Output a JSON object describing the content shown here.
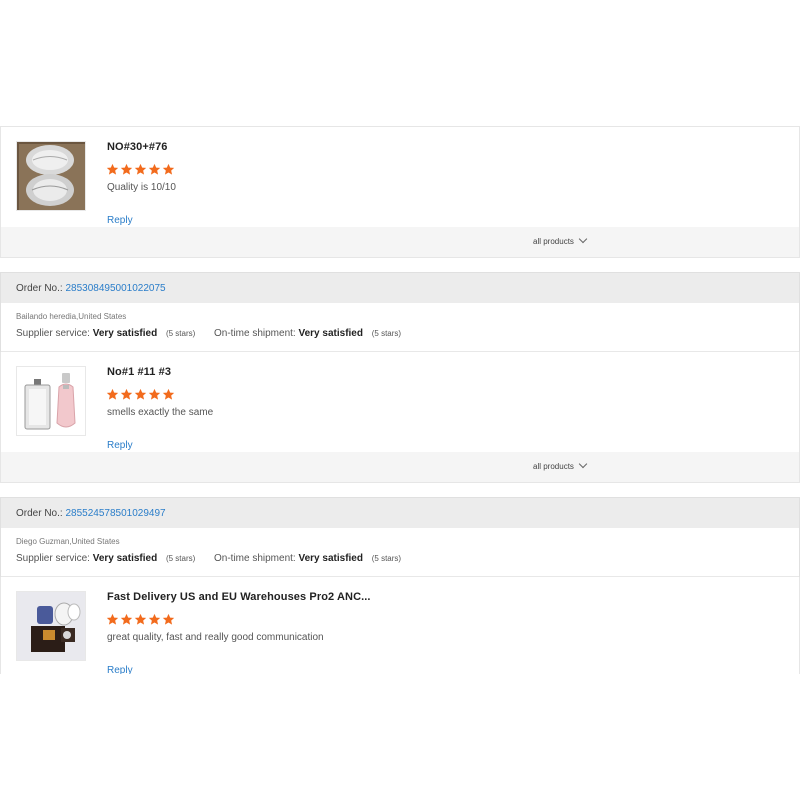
{
  "reviews_feed": {
    "first_item": {
      "product_name": "NO#30+#76",
      "rating": 5,
      "text": "Quality is 10/10",
      "reply_label": "Reply",
      "all_products_label": "all products"
    },
    "orders": [
      {
        "order_label": "Order No.:",
        "order_number": "285308495001022075",
        "buyer": "Bailando heredia,United States",
        "supplier_label": "Supplier service:",
        "supplier_value": "Very satisfied",
        "supplier_stars": "(5 stars)",
        "shipment_label": "On-time shipment:",
        "shipment_value": "Very satisfied",
        "shipment_stars": "(5 stars)",
        "item": {
          "product_name": "No#1 #11 #3",
          "rating": 5,
          "text": "smells exactly the same",
          "reply_label": "Reply",
          "all_products_label": "all products"
        }
      },
      {
        "order_label": "Order No.:",
        "order_number": "285524578501029497",
        "buyer": "Diego Guzman,United States",
        "supplier_label": "Supplier service:",
        "supplier_value": "Very satisfied",
        "supplier_stars": "(5 stars)",
        "shipment_label": "On-time shipment:",
        "shipment_value": "Very satisfied",
        "shipment_stars": "(5 stars)",
        "item": {
          "product_name": "Fast Delivery US and EU Warehouses Pro2 ANC...",
          "rating": 5,
          "text": "great quality, fast and really good communication",
          "reply_label": "Reply"
        }
      }
    ]
  },
  "colors": {
    "star": "#f26b1d",
    "link": "#2a7dc9",
    "order_header_bg": "#ececec",
    "footer_bg": "#f5f5f5"
  },
  "icons": {
    "star": "star-icon",
    "chevron": "chevron-down-icon"
  }
}
